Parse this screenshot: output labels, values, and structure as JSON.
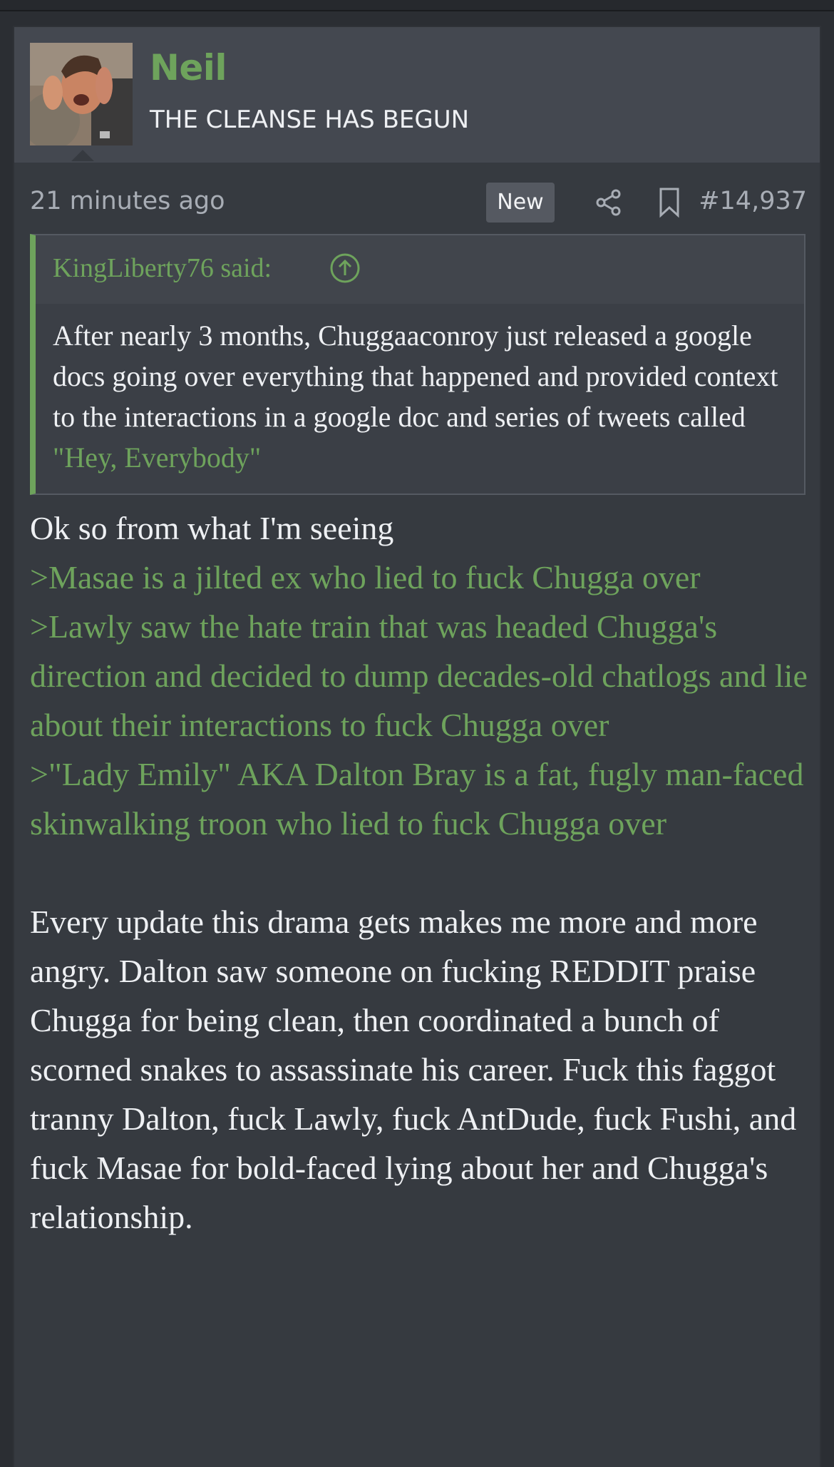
{
  "user": {
    "name": "Neil",
    "title": "THE CLEANSE HAS BEGUN"
  },
  "meta": {
    "time": "21 minutes ago",
    "badge": "New",
    "post_number": "#14,937"
  },
  "quote": {
    "author": "KingLiberty76 said:",
    "text": "After nearly 3 months, Chuggaaconroy just released a google docs going over everything that happened and provided context to the interactions in a google doc and series of tweets called ",
    "link_text": "\"Hey, Everybody\""
  },
  "body": {
    "intro": "Ok so from what I'm seeing",
    "greentext": [
      ">Masae is a jilted ex who lied to fuck Chugga over",
      ">Lawly saw the hate train that was headed Chugga's direction and decided to dump decades-old chatlogs and lie about their interactions to fuck Chugga over",
      ">\"Lady Emily\" AKA Dalton Bray is a fat, fugly man-faced skinwalking troon who lied to fuck Chugga over"
    ],
    "paragraph": "Every update this drama gets makes me more and more angry. Dalton saw someone on fucking REDDIT praise Chugga for being clean, then coordinated a bunch of scorned snakes to assassinate his career. Fuck this faggot tranny Dalton, fuck Lawly, fuck AntDude, fuck Fushi, and fuck Masae for bold-faced lying about her and Chugga's relationship."
  },
  "colors": {
    "accent_green": "#6ea35c",
    "post_bg": "#363a40",
    "userbar_bg": "#444850"
  },
  "icons": {
    "share": "share-icon",
    "bookmark": "bookmark-icon",
    "quote_jump": "arrow-up-circle-icon"
  }
}
